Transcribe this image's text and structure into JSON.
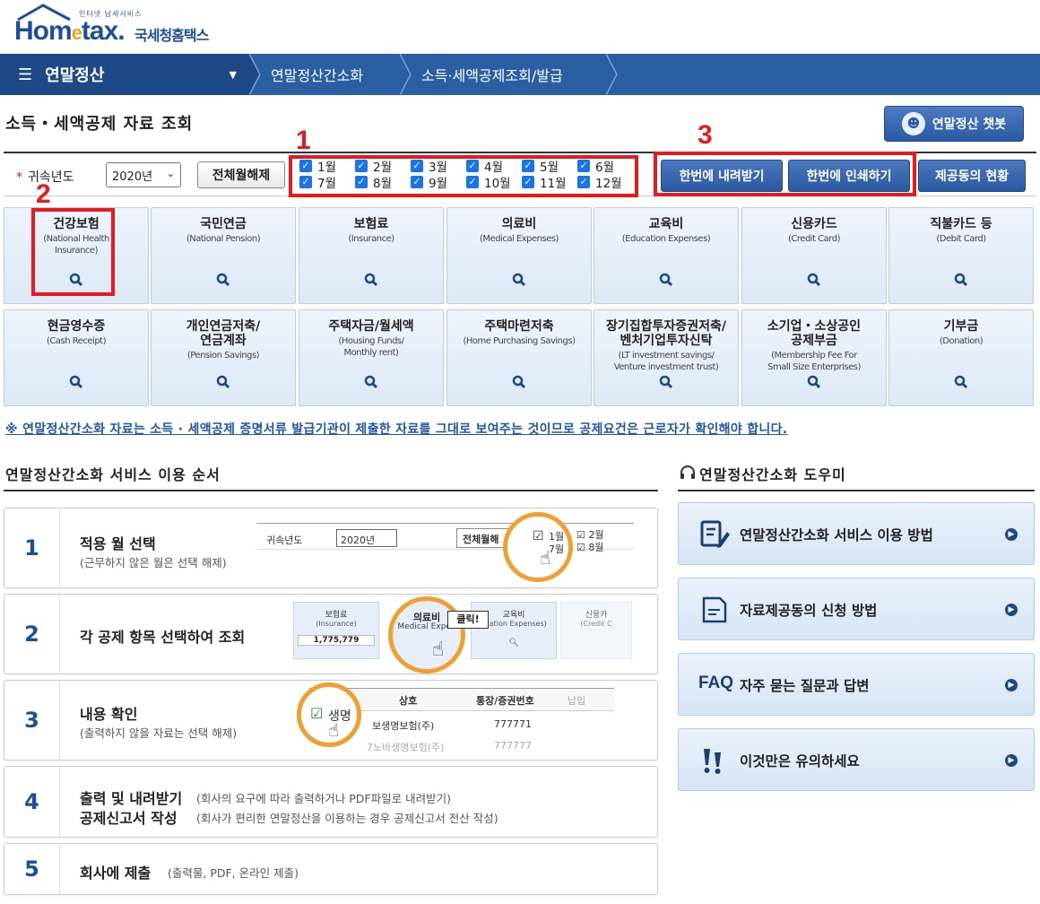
{
  "header": {
    "logo_small": "인터넷 납세서비스",
    "logo_brand_a": "Hom",
    "logo_brand_e": "e",
    "logo_brand_b": "tax.",
    "logo_kor": "국세청홈택스"
  },
  "nav": {
    "main_label": "연말정산",
    "crumbs": [
      "연말정산간소화",
      "소득·세액공제조회/발급"
    ]
  },
  "page": {
    "title": "소득・세액공제 자료 조회",
    "chatbot_label": "연말정산 챗봇"
  },
  "filter": {
    "year_label": "귀속년도",
    "year_value": "2020년",
    "clear_label": "전체월해제",
    "months": [
      "1월",
      "2월",
      "3월",
      "4월",
      "5월",
      "6월",
      "7월",
      "8월",
      "9월",
      "10월",
      "11월",
      "12월"
    ],
    "download_label": "한번에 내려받기",
    "print_label": "한번에 인쇄하기",
    "status_label": "제공동의 현황"
  },
  "annotations": {
    "n1": "1",
    "n2": "2",
    "n3": "3"
  },
  "tiles": [
    {
      "kt": "건강보험",
      "et": "(National Health\nInsurance)"
    },
    {
      "kt": "국민연금",
      "et": "(National Pension)"
    },
    {
      "kt": "보험료",
      "et": "(Insurance)"
    },
    {
      "kt": "의료비",
      "et": "(Medical Expenses)"
    },
    {
      "kt": "교육비",
      "et": "(Education Expenses)"
    },
    {
      "kt": "신용카드",
      "et": "(Credit Card)"
    },
    {
      "kt": "직불카드 등",
      "et": "(Debit Card)"
    },
    {
      "kt": "현금영수증",
      "et": "(Cash Receipt)"
    },
    {
      "kt": "개인연금저축/\n연금계좌",
      "et": "(Pension Savings)"
    },
    {
      "kt": "주택자금/월세액",
      "et": "(Housing Funds/\nMonthly rent)"
    },
    {
      "kt": "주택마련저축",
      "et": "(Home Purchasing Savings)"
    },
    {
      "kt": "장기집합투자증권저축/\n벤처기업투자신탁",
      "et": "(LT investment savings/\nVenture investment trust)"
    },
    {
      "kt": "소기업・소상공인\n공제부금",
      "et": "(Membership Fee For\nSmall Size Enterprises)"
    },
    {
      "kt": "기부금",
      "et": "(Donation)"
    }
  ],
  "notice": "※ 연말정산간소화 자료는 소득 · 세액공제 증명서류 발급기관이 제출한 자료를 그대로 보여주는 것이므로 공제요건은 근로자가 확인해야 합니다.",
  "steps_section": {
    "title": "연말정산간소화 서비스 이용 순서",
    "steps": [
      {
        "num": "1",
        "title": "적용 월 선택",
        "sub": "(근무하지 않은 월은 선택 해제)"
      },
      {
        "num": "2",
        "title": "각 공제 항목 선택하여 조회",
        "sub": ""
      },
      {
        "num": "3",
        "title": "내용 확인",
        "sub": "(출력하지 않을 자료는 선택 해제)"
      },
      {
        "num": "4",
        "title": "출력 및 내려받기",
        "sub": "(회사의 요구에 따라 출력하거나 PDF파일로 내려받기)",
        "title2": "공제신고서 작성",
        "sub2": "(회사가 편리한 연말정산을 이용하는 경우 공제신고서 전산 작성)"
      },
      {
        "num": "5",
        "title": "회사에 제출",
        "sub": "(출력물, PDF, 온라인 제출)"
      }
    ],
    "illus1": {
      "year_label": "귀속년도",
      "year": "2020년",
      "btn": "전체월해",
      "m1": "1월",
      "m2": "2월",
      "m7": "7월",
      "m8": "8월"
    },
    "illus2": {
      "t1": "보험료",
      "e1": "(Insurance)",
      "v1": "1,775,779",
      "t2": "의료비",
      "e2": "Medical Expen",
      "t3": "교육비",
      "e3": "ucation Expenses)",
      "t4": "신용카",
      "e4": "(Credit C",
      "click": "클릭!"
    },
    "illus3": {
      "h1": "상호",
      "h2": "통장/증권번호",
      "h3": "납입",
      "r1": "생명",
      "r1b": "보생명보험(주)",
      "r1c": "777771",
      "r2": "7노바생명보험(주)",
      "r2c": "777777"
    }
  },
  "help_section": {
    "title": "연말정산간소화 도우미",
    "items": [
      "연말정산간소화 서비스 이용 방법",
      "자료제공동의 신청 방법",
      "자주 묻는 질문과 답변",
      "이것만은 유의하세요"
    ],
    "faq_tag": "FAQ"
  },
  "colors": {
    "accent": "#2b5fa3",
    "dark_nav": "#1d4a87",
    "annotation_red": "#e8191f",
    "ring_orange": "#f0a030"
  }
}
